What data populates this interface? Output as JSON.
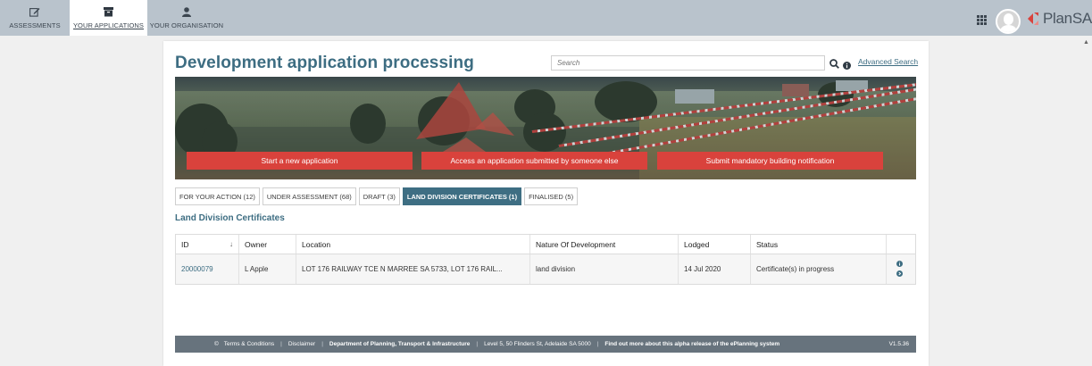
{
  "nav": {
    "assessments": "ASSESSMENTS",
    "your_applications": "YOUR APPLICATIONS",
    "your_organisation": "YOUR ORGANISATION"
  },
  "brand": {
    "name": "PlanSA"
  },
  "page": {
    "title": "Development application processing",
    "search_placeholder": "Search",
    "advanced_search": "Advanced Search"
  },
  "banner_buttons": {
    "start": "Start a new application",
    "access": "Access an application submitted by someone else",
    "submit": "Submit mandatory building notification"
  },
  "tabs": [
    {
      "label": "FOR YOUR ACTION (12)",
      "active": false
    },
    {
      "label": "UNDER ASSESSMENT (68)",
      "active": false
    },
    {
      "label": "DRAFT (3)",
      "active": false
    },
    {
      "label": "LAND DIVISION CERTIFICATES (1)",
      "active": true
    },
    {
      "label": "FINALISED (5)",
      "active": false
    }
  ],
  "section_title": "Land Division Certificates",
  "table": {
    "headers": {
      "id": "ID",
      "sort": "↓",
      "owner": "Owner",
      "location": "Location",
      "nature": "Nature Of Development",
      "lodged": "Lodged",
      "status": "Status"
    },
    "rows": [
      {
        "id": "20000079",
        "owner": "L Apple",
        "location": "LOT 176 RAILWAY TCE N MARREE SA 5733, LOT 176 RAIL...",
        "nature": "land division",
        "lodged": "14 Jul 2020",
        "status": "Certificate(s) in progress"
      }
    ]
  },
  "footer": {
    "copyright": "©",
    "terms": "Terms & Conditions",
    "disclaimer": "Disclaimer",
    "department": "Department of Planning, Transport & Infrastructure",
    "address": "Level 5, 50 Flinders St, Adelaide SA 5000",
    "alpha": "Find out more about this alpha release of the ePlanning system",
    "version": "V1.5.36",
    "separator": "|"
  },
  "colors": {
    "accent": "#3d6d82",
    "button_red": "#d9423c",
    "topbar": "#b9c3cc",
    "footer": "#67737d"
  }
}
